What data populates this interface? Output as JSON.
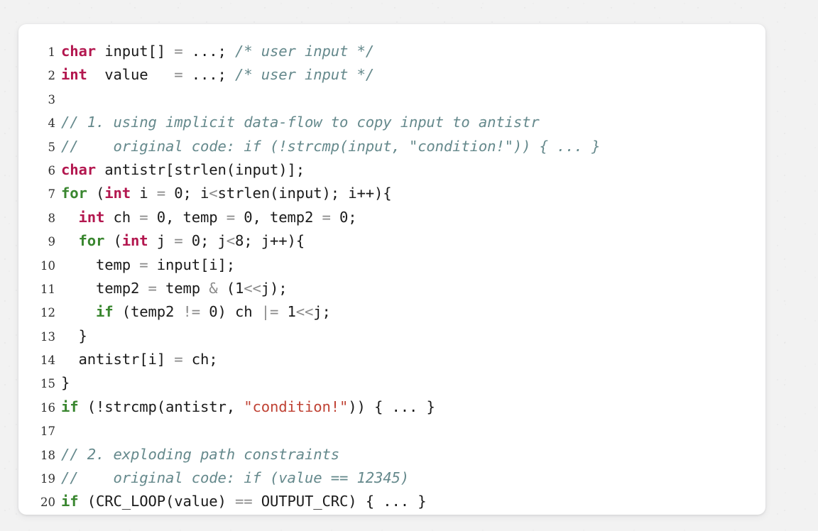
{
  "listing": {
    "language": "c",
    "colors": {
      "background": "#f2f2f2",
      "card": "#ffffff",
      "keyword_type": "#b3174f",
      "keyword_control": "#39862f",
      "string": "#c04335",
      "comment": "#65898c",
      "operator": "#8a8a8a",
      "identifier": "#1b1b1b",
      "line_number": "#2f2f2f"
    },
    "lines": [
      {
        "number": "1",
        "text": "char input[] = ...; /* user input */",
        "tokens": [
          {
            "t": "char",
            "c": "tok-kw-type"
          },
          {
            "t": " input[] ",
            "c": "tok-plain"
          },
          {
            "t": "=",
            "c": "tok-op"
          },
          {
            "t": " ...; ",
            "c": "tok-plain"
          },
          {
            "t": "/* user input */",
            "c": "tok-comment"
          }
        ]
      },
      {
        "number": "2",
        "text": "int  value   = ...; /* user input */",
        "tokens": [
          {
            "t": "int",
            "c": "tok-kw-type"
          },
          {
            "t": "  value   ",
            "c": "tok-plain"
          },
          {
            "t": "=",
            "c": "tok-op"
          },
          {
            "t": " ...; ",
            "c": "tok-plain"
          },
          {
            "t": "/* user input */",
            "c": "tok-comment"
          }
        ]
      },
      {
        "number": "3",
        "text": "",
        "tokens": []
      },
      {
        "number": "4",
        "text": "// 1. using implicit data-flow to copy input to antistr",
        "tokens": [
          {
            "t": "// 1. using implicit data-flow to copy input to antistr",
            "c": "tok-comment"
          }
        ]
      },
      {
        "number": "5",
        "text": "//    original code: if (!strcmp(input, \"condition!\")) { ... }",
        "tokens": [
          {
            "t": "//    original code: if (!strcmp(input, \"condition!\")) { ... }",
            "c": "tok-comment"
          }
        ]
      },
      {
        "number": "6",
        "text": "char antistr[strlen(input)];",
        "tokens": [
          {
            "t": "char",
            "c": "tok-kw-type"
          },
          {
            "t": " antistr[strlen(input)];",
            "c": "tok-plain"
          }
        ]
      },
      {
        "number": "7",
        "text": "for (int i = 0; i<strlen(input); i++){",
        "tokens": [
          {
            "t": "for",
            "c": "tok-kw-ctrl"
          },
          {
            "t": " (",
            "c": "tok-plain"
          },
          {
            "t": "int",
            "c": "tok-kw-type"
          },
          {
            "t": " i ",
            "c": "tok-plain"
          },
          {
            "t": "=",
            "c": "tok-op"
          },
          {
            "t": " ",
            "c": "tok-plain"
          },
          {
            "t": "0",
            "c": "tok-num"
          },
          {
            "t": "; i",
            "c": "tok-plain"
          },
          {
            "t": "<",
            "c": "tok-op"
          },
          {
            "t": "strlen(input); i++){",
            "c": "tok-plain"
          }
        ]
      },
      {
        "number": "8",
        "text": "  int ch = 0, temp = 0, temp2 = 0;",
        "tokens": [
          {
            "t": "  ",
            "c": "tok-plain"
          },
          {
            "t": "int",
            "c": "tok-kw-type"
          },
          {
            "t": " ch ",
            "c": "tok-plain"
          },
          {
            "t": "=",
            "c": "tok-op"
          },
          {
            "t": " ",
            "c": "tok-plain"
          },
          {
            "t": "0",
            "c": "tok-num"
          },
          {
            "t": ", temp ",
            "c": "tok-plain"
          },
          {
            "t": "=",
            "c": "tok-op"
          },
          {
            "t": " ",
            "c": "tok-plain"
          },
          {
            "t": "0",
            "c": "tok-num"
          },
          {
            "t": ", temp2 ",
            "c": "tok-plain"
          },
          {
            "t": "=",
            "c": "tok-op"
          },
          {
            "t": " ",
            "c": "tok-plain"
          },
          {
            "t": "0",
            "c": "tok-num"
          },
          {
            "t": ";",
            "c": "tok-plain"
          }
        ]
      },
      {
        "number": "9",
        "text": "  for (int j = 0; j<8; j++){",
        "tokens": [
          {
            "t": "  ",
            "c": "tok-plain"
          },
          {
            "t": "for",
            "c": "tok-kw-ctrl"
          },
          {
            "t": " (",
            "c": "tok-plain"
          },
          {
            "t": "int",
            "c": "tok-kw-type"
          },
          {
            "t": " j ",
            "c": "tok-plain"
          },
          {
            "t": "=",
            "c": "tok-op"
          },
          {
            "t": " ",
            "c": "tok-plain"
          },
          {
            "t": "0",
            "c": "tok-num"
          },
          {
            "t": "; j",
            "c": "tok-plain"
          },
          {
            "t": "<",
            "c": "tok-op"
          },
          {
            "t": "8",
            "c": "tok-num"
          },
          {
            "t": "; j++){",
            "c": "tok-plain"
          }
        ]
      },
      {
        "number": "10",
        "text": "    temp = input[i];",
        "tokens": [
          {
            "t": "    temp ",
            "c": "tok-plain"
          },
          {
            "t": "=",
            "c": "tok-op"
          },
          {
            "t": " input[i];",
            "c": "tok-plain"
          }
        ]
      },
      {
        "number": "11",
        "text": "    temp2 = temp & (1<<j);",
        "tokens": [
          {
            "t": "    temp2 ",
            "c": "tok-plain"
          },
          {
            "t": "=",
            "c": "tok-op"
          },
          {
            "t": " temp ",
            "c": "tok-plain"
          },
          {
            "t": "&",
            "c": "tok-op"
          },
          {
            "t": " (",
            "c": "tok-plain"
          },
          {
            "t": "1",
            "c": "tok-num"
          },
          {
            "t": "<<",
            "c": "tok-op"
          },
          {
            "t": "j);",
            "c": "tok-plain"
          }
        ]
      },
      {
        "number": "12",
        "text": "    if (temp2 != 0) ch |= 1<<j;",
        "tokens": [
          {
            "t": "    ",
            "c": "tok-plain"
          },
          {
            "t": "if",
            "c": "tok-kw-ctrl"
          },
          {
            "t": " (temp2 ",
            "c": "tok-plain"
          },
          {
            "t": "!=",
            "c": "tok-op"
          },
          {
            "t": " ",
            "c": "tok-plain"
          },
          {
            "t": "0",
            "c": "tok-num"
          },
          {
            "t": ") ch ",
            "c": "tok-plain"
          },
          {
            "t": "|=",
            "c": "tok-op"
          },
          {
            "t": " ",
            "c": "tok-plain"
          },
          {
            "t": "1",
            "c": "tok-num"
          },
          {
            "t": "<<",
            "c": "tok-op"
          },
          {
            "t": "j;",
            "c": "tok-plain"
          }
        ]
      },
      {
        "number": "13",
        "text": "  }",
        "tokens": [
          {
            "t": "  }",
            "c": "tok-plain"
          }
        ]
      },
      {
        "number": "14",
        "text": "  antistr[i] = ch;",
        "tokens": [
          {
            "t": "  antistr[i] ",
            "c": "tok-plain"
          },
          {
            "t": "=",
            "c": "tok-op"
          },
          {
            "t": " ch;",
            "c": "tok-plain"
          }
        ]
      },
      {
        "number": "15",
        "text": "}",
        "tokens": [
          {
            "t": "}",
            "c": "tok-plain"
          }
        ]
      },
      {
        "number": "16",
        "text": "if (!strcmp(antistr, \"condition!\")) { ... }",
        "tokens": [
          {
            "t": "if",
            "c": "tok-kw-ctrl"
          },
          {
            "t": " (!strcmp(antistr, ",
            "c": "tok-plain"
          },
          {
            "t": "\"condition!\"",
            "c": "tok-string"
          },
          {
            "t": ")) { ... }",
            "c": "tok-plain"
          }
        ]
      },
      {
        "number": "17",
        "text": "",
        "tokens": []
      },
      {
        "number": "18",
        "text": "// 2. exploding path constraints",
        "tokens": [
          {
            "t": "// 2. exploding path constraints",
            "c": "tok-comment"
          }
        ]
      },
      {
        "number": "19",
        "text": "//    original code: if (value == 12345)",
        "tokens": [
          {
            "t": "//    original code: if (value == 12345)",
            "c": "tok-comment"
          }
        ]
      },
      {
        "number": "20",
        "text": "if (CRC_LOOP(value) == OUTPUT_CRC) { ... }",
        "tokens": [
          {
            "t": "if",
            "c": "tok-kw-ctrl"
          },
          {
            "t": " (CRC_LOOP(value) ",
            "c": "tok-plain"
          },
          {
            "t": "==",
            "c": "tok-op"
          },
          {
            "t": " OUTPUT_CRC) { ... }",
            "c": "tok-plain"
          }
        ]
      }
    ]
  }
}
